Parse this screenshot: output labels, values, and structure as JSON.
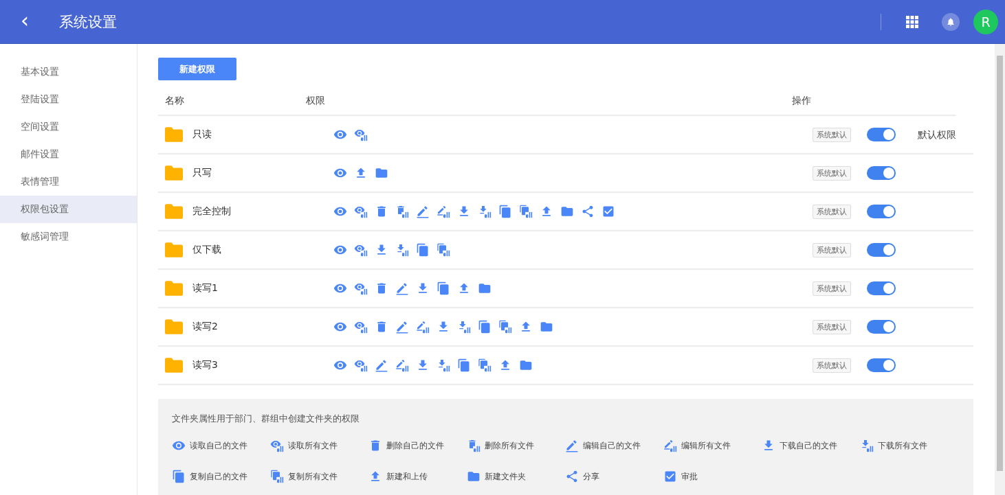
{
  "header": {
    "back_icon": "‹",
    "title": "系统设置",
    "avatar": "R"
  },
  "sidebar": {
    "items": [
      {
        "label": "基本设置",
        "selected": false
      },
      {
        "label": "登陆设置",
        "selected": false
      },
      {
        "label": "空间设置",
        "selected": false
      },
      {
        "label": "邮件设置",
        "selected": false
      },
      {
        "label": "表情管理",
        "selected": false
      },
      {
        "label": "权限包设置",
        "selected": true
      },
      {
        "label": "敏感词管理",
        "selected": false
      }
    ]
  },
  "new_button": "新建权限",
  "table": {
    "columns": [
      "名称",
      "权限",
      "操作"
    ],
    "rows": [
      {
        "name": "只读",
        "permissions": [
          {
            "kind": "read_own"
          },
          {
            "kind": "read_all"
          }
        ],
        "tag": "系统默认",
        "on": true,
        "note": "默认权限"
      },
      {
        "name": "只写",
        "permissions": [
          {
            "kind": "read_own"
          },
          {
            "kind": "upload"
          },
          {
            "kind": "new_folder"
          }
        ],
        "tag": "系统默认",
        "on": true
      },
      {
        "name": "完全控制",
        "permissions": [
          {
            "kind": "read_own"
          },
          {
            "kind": "read_all"
          },
          {
            "kind": "delete_own"
          },
          {
            "kind": "delete_all"
          },
          {
            "kind": "edit_own"
          },
          {
            "kind": "edit_all"
          },
          {
            "kind": "download_own"
          },
          {
            "kind": "download_all"
          },
          {
            "kind": "copy_own"
          },
          {
            "kind": "copy_all"
          },
          {
            "kind": "upload"
          },
          {
            "kind": "new_folder"
          },
          {
            "kind": "share"
          },
          {
            "kind": "approve"
          }
        ],
        "tag": "系统默认",
        "on": true
      },
      {
        "name": "仅下载",
        "permissions": [
          {
            "kind": "read_own"
          },
          {
            "kind": "read_all"
          },
          {
            "kind": "download_own"
          },
          {
            "kind": "download_all"
          },
          {
            "kind": "copy_own"
          },
          {
            "kind": "copy_all"
          }
        ],
        "tag": "系统默认",
        "on": true
      },
      {
        "name": "读写1",
        "permissions": [
          {
            "kind": "read_own"
          },
          {
            "kind": "read_all"
          },
          {
            "kind": "delete_own"
          },
          {
            "kind": "edit_own"
          },
          {
            "kind": "download_own"
          },
          {
            "kind": "copy_own"
          },
          {
            "kind": "upload"
          },
          {
            "kind": "new_folder"
          }
        ],
        "tag": "系统默认",
        "on": true
      },
      {
        "name": "读写2",
        "permissions": [
          {
            "kind": "read_own"
          },
          {
            "kind": "read_all"
          },
          {
            "kind": "delete_own"
          },
          {
            "kind": "edit_own"
          },
          {
            "kind": "edit_all"
          },
          {
            "kind": "download_own"
          },
          {
            "kind": "download_all"
          },
          {
            "kind": "copy_own"
          },
          {
            "kind": "copy_all"
          },
          {
            "kind": "upload"
          },
          {
            "kind": "new_folder"
          }
        ],
        "tag": "系统默认",
        "on": true
      },
      {
        "name": "读写3",
        "permissions": [
          {
            "kind": "read_own"
          },
          {
            "kind": "read_all"
          },
          {
            "kind": "edit_own"
          },
          {
            "kind": "edit_all"
          },
          {
            "kind": "download_own"
          },
          {
            "kind": "download_all"
          },
          {
            "kind": "copy_own"
          },
          {
            "kind": "copy_all"
          },
          {
            "kind": "upload"
          },
          {
            "kind": "new_folder"
          }
        ],
        "tag": "系统默认",
        "on": true
      }
    ]
  },
  "legend": {
    "title": "文件夹属性用于部门、群组中创建文件夹的权限",
    "items": [
      {
        "kind": "read_own",
        "label": "读取自己的文件"
      },
      {
        "kind": "read_all",
        "label": "读取所有文件"
      },
      {
        "kind": "delete_own",
        "label": "删除自己的文件"
      },
      {
        "kind": "delete_all",
        "label": "删除所有文件"
      },
      {
        "kind": "edit_own",
        "label": "编辑自己的文件"
      },
      {
        "kind": "edit_all",
        "label": "编辑所有文件"
      },
      {
        "kind": "download_own",
        "label": "下载自己的文件"
      },
      {
        "kind": "download_all",
        "label": "下载所有文件"
      },
      {
        "kind": "copy_own",
        "label": "复制自己的文件"
      },
      {
        "kind": "copy_all",
        "label": "复制所有文件"
      },
      {
        "kind": "upload",
        "label": "新建和上传"
      },
      {
        "kind": "new_folder",
        "label": "新建文件夹"
      },
      {
        "kind": "share",
        "label": "分享"
      },
      {
        "kind": "approve",
        "label": "审批"
      }
    ]
  }
}
